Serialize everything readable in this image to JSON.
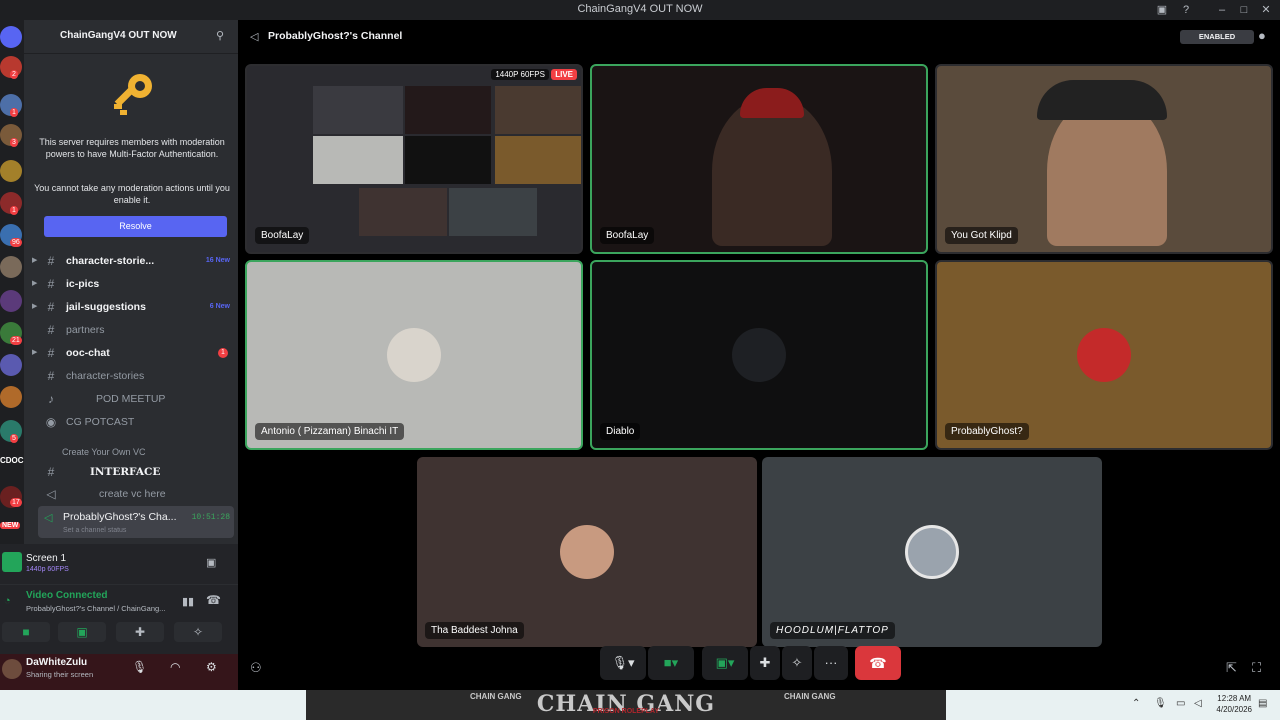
{
  "window": {
    "title": "ChainGangV4 OUT NOW"
  },
  "servers": {
    "badges": [
      "2",
      "1",
      "3",
      "1",
      "96",
      "21",
      "5",
      "17"
    ],
    "labels": [
      "NEW"
    ],
    "doc_label": "CDOC"
  },
  "sidebar": {
    "server_name": "ChainGangV4 OUT NOW",
    "mfa": {
      "message": "This server requires members with moderation powers to have Multi-Factor Authentication.",
      "message2": "You cannot take any moderation actions until you enable it.",
      "resolve_label": "Resolve"
    },
    "channels": [
      {
        "icon": "#",
        "label": "character-storie...",
        "bold": true,
        "new": "16 New"
      },
      {
        "icon": "#",
        "label": "ic-pics",
        "bold": true
      },
      {
        "icon": "#",
        "label": "jail-suggestions",
        "bold": true,
        "new": "6 New"
      },
      {
        "icon": "#",
        "label": "partners",
        "bold": false
      },
      {
        "icon": "#",
        "label": "ooc-chat",
        "bold": true,
        "badge": "1"
      },
      {
        "icon": "#",
        "label": "character-stories",
        "bold": false
      },
      {
        "icon": "♪",
        "label": "POD MEETUP",
        "bold": false
      },
      {
        "icon": "◉",
        "label": "CG POTCAST",
        "bold": false
      },
      {
        "icon": "",
        "label": "Create Your Own VC",
        "bold": false
      },
      {
        "icon": "#",
        "label": "INTERFACE",
        "bold": true
      },
      {
        "icon": "◁",
        "label": "create vc here",
        "bold": false
      }
    ],
    "active_channel": {
      "name": "ProbablyGhost?'s Cha...",
      "time": "10:51:28",
      "status": "Set a channel status"
    }
  },
  "panel": {
    "screen": {
      "title": "Screen 1",
      "sub": "1440p 60FPS"
    },
    "voice": {
      "title": "Video Connected",
      "sub": "ProbablyGhost?'s Channel / ChainGang..."
    },
    "user": {
      "name": "DaWhiteZulu",
      "status": "Sharing their screen"
    }
  },
  "stage": {
    "title": "ProbablyGhost?'s Channel",
    "enabled_label": "ENABLED",
    "stream_quality": "1440P 60FPS",
    "live_label": "LIVE",
    "tiles": [
      {
        "name": "BoofaLay",
        "color": "#2a2a2f"
      },
      {
        "name": "BoofaLay",
        "color": "#1a1414"
      },
      {
        "name": "You Got Klipd",
        "color": "#5a4b3c"
      },
      {
        "name": "Antonio ( Pizzaman) Binachi IT",
        "color": "#b8b9b6"
      },
      {
        "name": "Diablo",
        "color": "#0f0f10"
      },
      {
        "name": "ProbablyGhost?",
        "color": "#7a5a2c"
      },
      {
        "name": "Tha Baddest Johna",
        "color": "#3f3331"
      },
      {
        "name": "HOODLUM|FLATTOP",
        "color": "#3c4145"
      }
    ]
  },
  "taskbar": {
    "banner": "CHAIN GANG",
    "banner_sub": "PRISON ROLEPLAY",
    "side_label": "CHAIN GANG",
    "time": "12:28 AM",
    "date": "4/20/2026"
  }
}
